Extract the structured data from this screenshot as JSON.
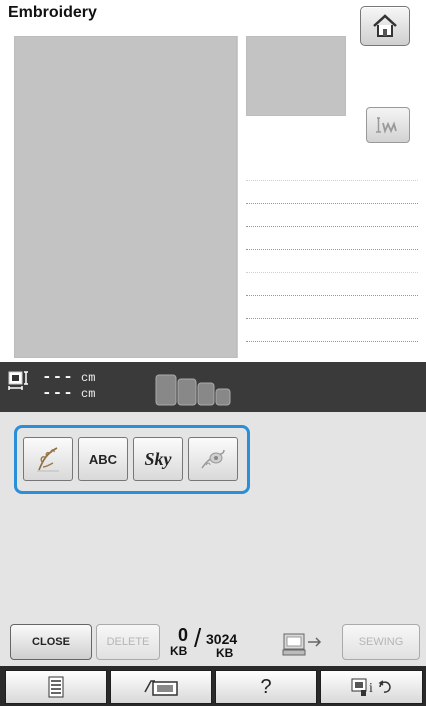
{
  "header": {
    "title": "Embroidery"
  },
  "size": {
    "height_value": "---",
    "height_unit": "cm",
    "width_value": "---",
    "width_unit": "cm"
  },
  "categories": [
    {
      "name": "embroidery-patterns",
      "icon": "floral-pattern-icon"
    },
    {
      "name": "character-patterns",
      "label": "ABC"
    },
    {
      "name": "decorative-alphabet",
      "label": "Sky"
    },
    {
      "name": "frame-patterns",
      "icon": "ornament-icon"
    }
  ],
  "bottom": {
    "close_label": "CLOSE",
    "delete_label": "DELETE",
    "memory_used": "0",
    "memory_total": "3024",
    "memory_unit": "KB",
    "sewing_label": "SEWING"
  },
  "footer": {
    "help_label": "?",
    "icons": [
      "settings-sheet-icon",
      "camera-hoop-icon",
      "help-icon",
      "machine-info-icon"
    ]
  },
  "colors": {
    "selection_border": "#2a8fd6",
    "dark_bar": "#3a3a3a",
    "preview_fill": "#c3c3c3"
  }
}
